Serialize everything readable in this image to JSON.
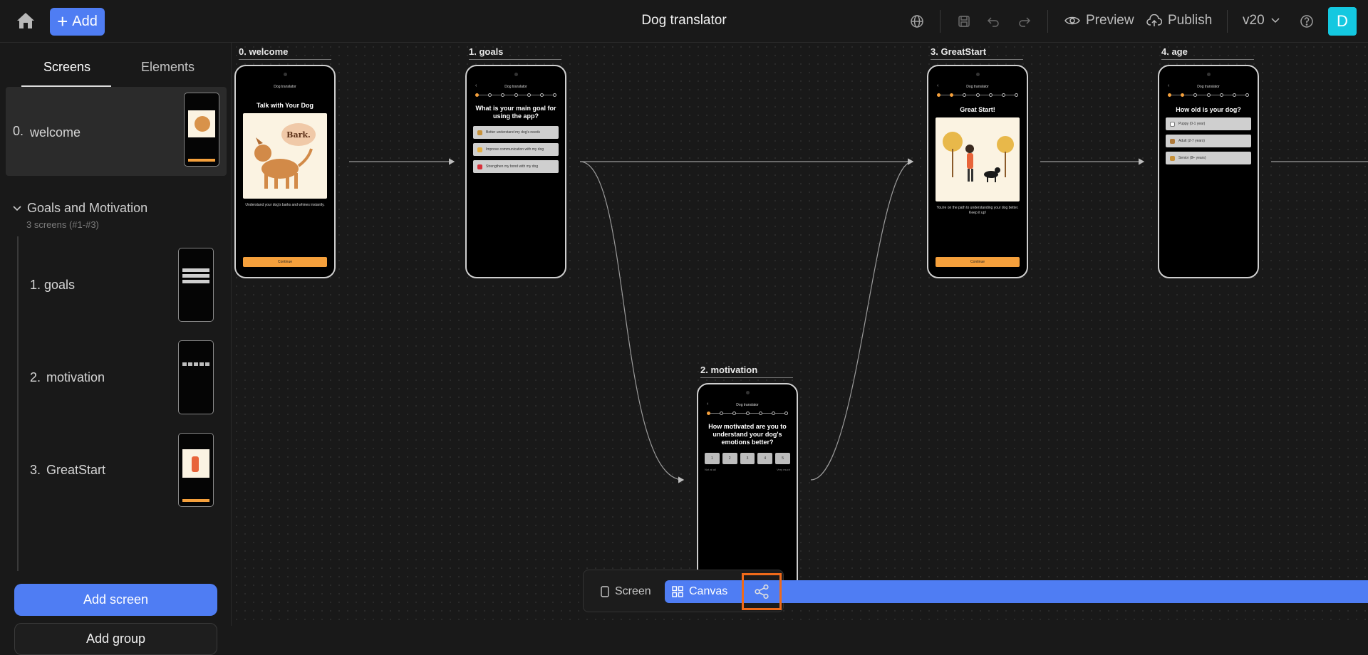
{
  "header": {
    "add_label": "Add",
    "title": "Dog translator",
    "preview_label": "Preview",
    "publish_label": "Publish",
    "version": "v20",
    "avatar_initial": "D"
  },
  "sidebar": {
    "tabs": [
      "Screens",
      "Elements"
    ],
    "items": [
      {
        "num": "0.",
        "label": "welcome"
      },
      {
        "num": "1.",
        "label": "goals"
      },
      {
        "num": "2.",
        "label": "motivation"
      },
      {
        "num": "3.",
        "label": "GreatStart"
      }
    ],
    "group": {
      "label": "Goals and Motivation",
      "sub": "3 screens (#1-#3)"
    },
    "add_screen": "Add screen",
    "add_group": "Add group"
  },
  "canvas": {
    "frames": [
      {
        "label": "0. welcome"
      },
      {
        "label": "1. goals"
      },
      {
        "label": "2. motivation"
      },
      {
        "label": "3. GreatStart"
      },
      {
        "label": "4. age"
      }
    ],
    "phone_app": "Dog translator",
    "welcome": {
      "title": "Talk with Your Dog",
      "bubble": "Bark.",
      "text": "Understand your dog's barks and whines instantly.",
      "cta": "Continue"
    },
    "goals": {
      "title": "What is your main goal for using the app?",
      "options": [
        "Better understand my dog's needs",
        "Improve communication with my dog",
        "Strengthen my bond with my dog"
      ]
    },
    "motivation": {
      "title": "How motivated are you to understand your dog's emotions better?",
      "scale": [
        "1",
        "2",
        "3",
        "4",
        "5"
      ],
      "low": "Not at all",
      "high": "Very much"
    },
    "greatstart": {
      "title": "Great Start!",
      "text": "You're on the path to understanding your dog better. Keep it up!",
      "cta": "Continue"
    },
    "age": {
      "title": "How old is your dog?",
      "options": [
        "Puppy (0-1 year)",
        "Adult (2-7 years)",
        "Senior (8+ years)"
      ]
    }
  },
  "viewbar": {
    "screen_label": "Screen",
    "canvas_label": "Canvas"
  },
  "colors": {
    "accent": "#4f7df3",
    "orange": "#f5a03c",
    "highlight": "#ef6a1a"
  }
}
